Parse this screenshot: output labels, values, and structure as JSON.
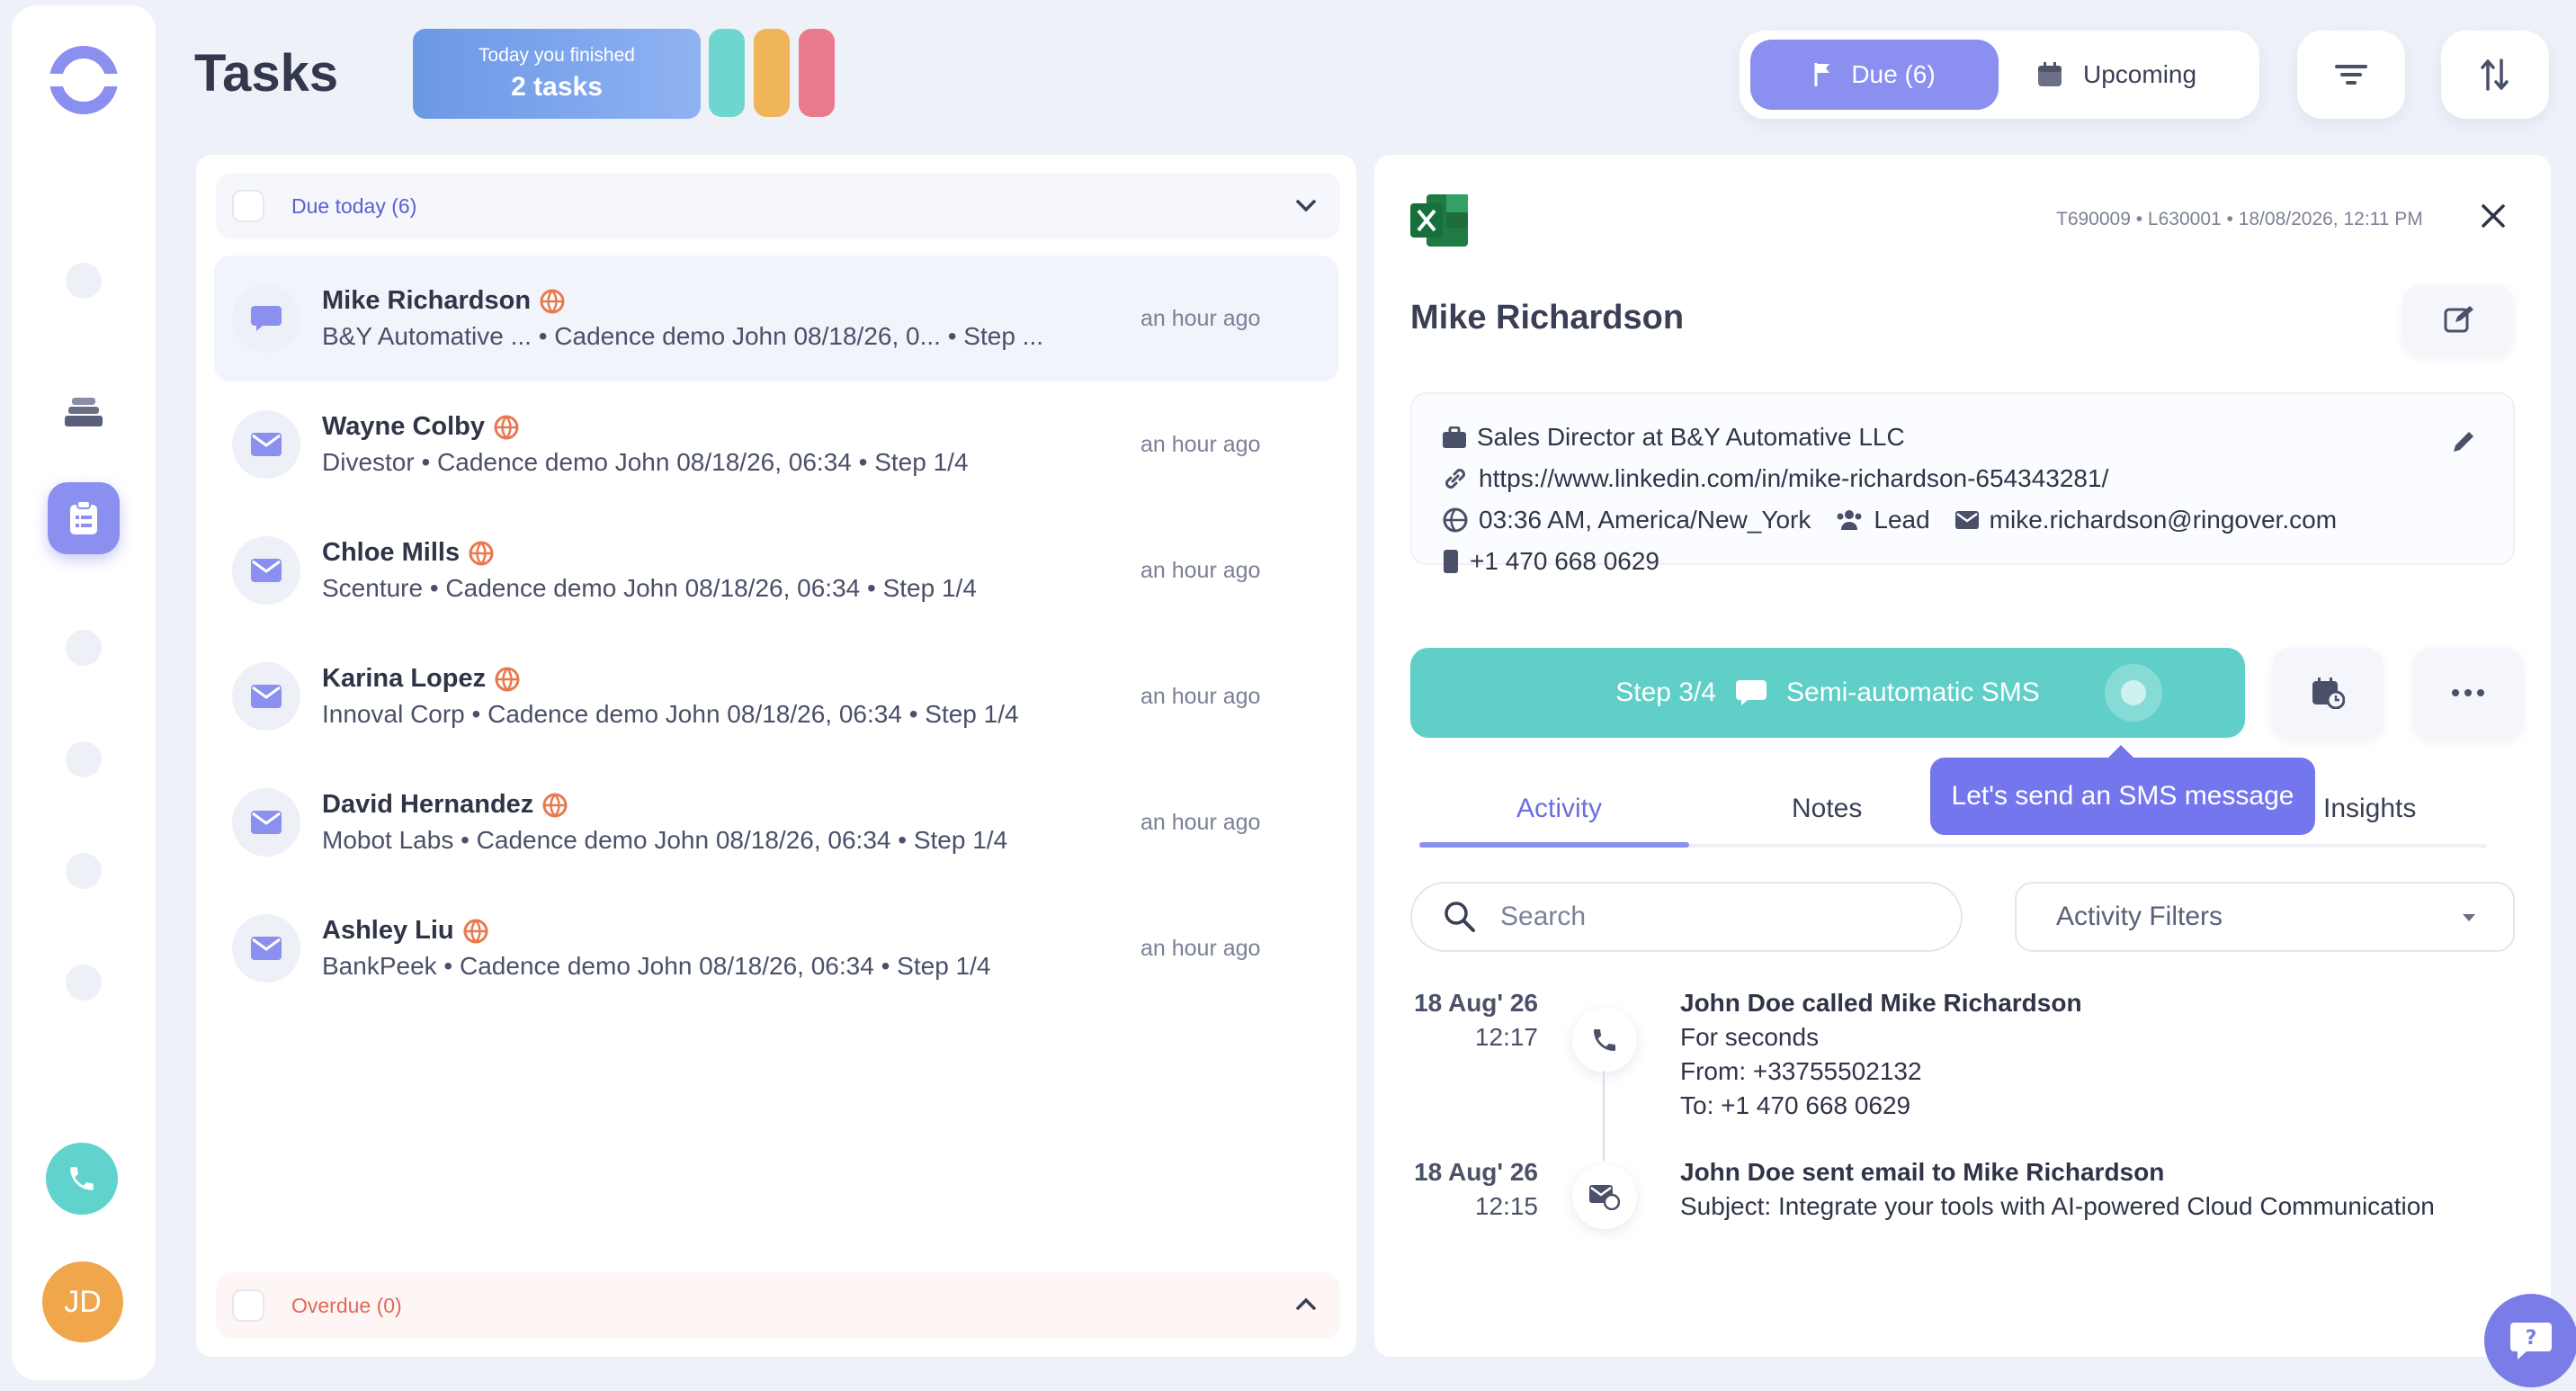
{
  "page": {
    "title": "Tasks"
  },
  "finished": {
    "line1": "Today you finished",
    "line2": "2 tasks"
  },
  "toggle": {
    "due": "Due (6)",
    "upcoming": "Upcoming"
  },
  "colors": {
    "accent": "#8b8ff0",
    "teal": "#5fcfc8",
    "orange": "#f0b459",
    "pink": "#e97a8e",
    "tooltip": "#7476ee"
  },
  "list": {
    "due_header": "Due today (6)",
    "overdue_header": "Overdue (0)",
    "rows": [
      {
        "name": "Mike Richardson",
        "sub": "B&Y Automative ...   • Cadence demo John 08/18/26, 0...   • Step ...",
        "time": "an hour ago",
        "icon": "chat-icon"
      },
      {
        "name": "Wayne Colby",
        "sub": "Divestor • Cadence demo John 08/18/26, 06:34 • Step 1/4",
        "time": "an hour ago",
        "icon": "mail-icon"
      },
      {
        "name": "Chloe Mills",
        "sub": "Scenture • Cadence demo John 08/18/26, 06:34 • Step 1/4",
        "time": "an hour ago",
        "icon": "mail-icon"
      },
      {
        "name": "Karina Lopez",
        "sub": "Innoval Corp • Cadence demo John 08/18/26, 06:34 • Step 1/4",
        "time": "an hour ago",
        "icon": "mail-icon"
      },
      {
        "name": "David Hernandez",
        "sub": "Mobot Labs • Cadence demo John 08/18/26, 06:34 • Step 1/4",
        "time": "an hour ago",
        "icon": "mail-icon"
      },
      {
        "name": "Ashley Liu",
        "sub": "BankPeek • Cadence demo John 08/18/26, 06:34 • Step 1/4",
        "time": "an hour ago",
        "icon": "mail-icon"
      }
    ]
  },
  "detail": {
    "meta": "T690009 • L630001 • 18/08/2026, 12:11 PM",
    "name": "Mike Richardson",
    "title_line": "Sales Director at B&Y Automative LLC",
    "linkedin": "https://www.linkedin.com/in/mike-richardson-654343281/",
    "local_time": "03:36 AM, America/New_York",
    "status": "Lead",
    "email": "mike.richardson@ringover.com",
    "phone": "+1 470 668 0629",
    "step": "Step 3/4",
    "step_type": "Semi-automatic SMS",
    "tooltip": "Let's send an SMS message",
    "tabs": [
      "Activity",
      "Notes",
      "l Insights"
    ],
    "search_placeholder": "Search",
    "filters_label": "Activity Filters",
    "activities": [
      {
        "date": "18 Aug' 26",
        "time": "12:17",
        "title": "John Doe called Mike Richardson",
        "lines": [
          "For seconds",
          "From: +33755502132",
          "To: +1 470 668 0629"
        ]
      },
      {
        "date": "18 Aug' 26",
        "time": "12:15",
        "title": "John Doe sent email to Mike Richardson",
        "lines": [
          "Subject: Integrate your tools with AI-powered Cloud Communication"
        ]
      }
    ]
  },
  "user": {
    "initials": "JD"
  }
}
